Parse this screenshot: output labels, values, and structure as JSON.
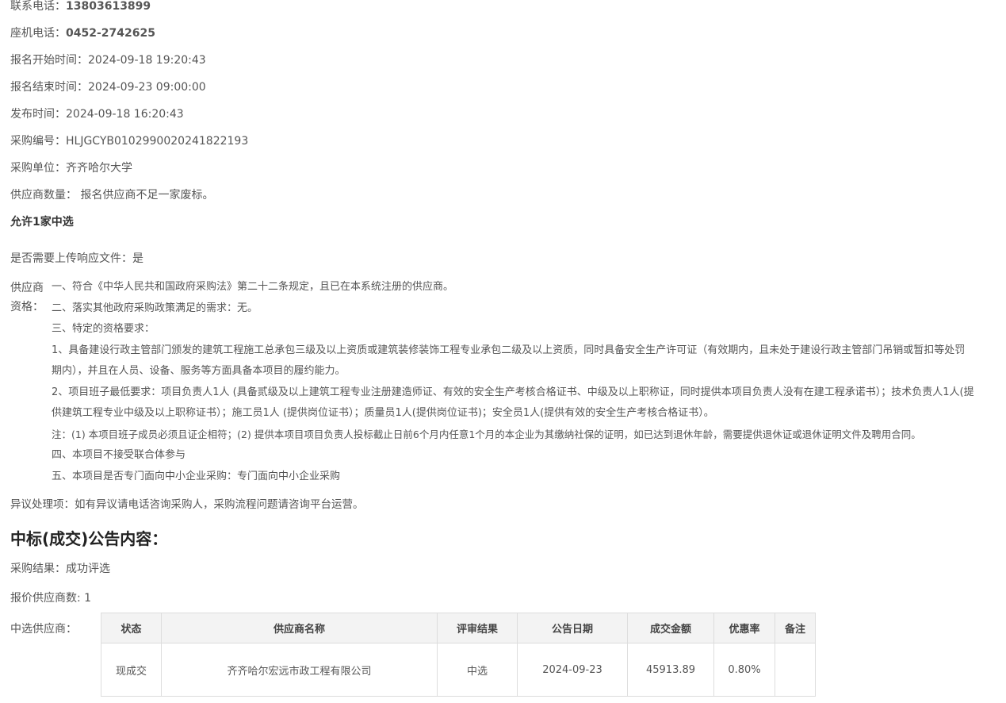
{
  "contact": {
    "phone_label": "联系电话：",
    "phone_value": "13803613899",
    "landline_label": "座机电话：",
    "landline_value": "0452-2742625"
  },
  "dates": {
    "signup_start_label": "报名开始时间：",
    "signup_start_value": "2024-09-18 19:20:43",
    "signup_end_label": "报名结束时间：",
    "signup_end_value": "2024-09-23 09:00:00",
    "publish_label": "发布时间：",
    "publish_value": "2024-09-18 16:20:43"
  },
  "procurement": {
    "code_label": "采购编号：",
    "code_value": "HLJGCYB0102990020241822193",
    "unit_label": "采购单位：",
    "unit_value": "齐齐哈尔大学",
    "supplier_count_label": "供应商数量：",
    "supplier_count_value": "报名供应商不足一家废标。",
    "allow_text": "允许1家中选",
    "upload_label": "是否需要上传响应文件：",
    "upload_value": "是"
  },
  "qualification": {
    "label": "供应商资格：",
    "lines": [
      "一、符合《中华人民共和国政府采购法》第二十二条规定，且已在本系统注册的供应商。",
      "二、落实其他政府采购政策满足的需求：无。",
      "三、特定的资格要求：",
      "1、具备建设行政主管部门颁发的建筑工程施工总承包三级及以上资质或建筑装修装饰工程专业承包二级及以上资质，同时具备安全生产许可证（有效期内，且未处于建设行政主管部门吊销或暂扣等处罚期内），并且在人员、设备、服务等方面具备本项目的履约能力。",
      "2、项目班子最低要求：项目负责人1人 (具备贰级及以上建筑工程专业注册建造师证、有效的安全生产考核合格证书、中级及以上职称证，同时提供本项目负责人没有在建工程承诺书）；技术负责人1人(提供建筑工程专业中级及以上职称证书）；施工员1人 (提供岗位证书）；质量员1人(提供岗位证书)；安全员1人(提供有效的安全生产考核合格证书）。",
      "注：(1) 本项目班子成员必须且证企相符；(2) 提供本项目项目负责人投标截止日前6个月内任意1个月的本企业为其缴纳社保的证明，如已达到退休年龄，需要提供退休证或退休证明文件及聘用合同。",
      "四、本项目不接受联合体参与",
      "五、本项目是否专门面向中小企业采购：专门面向中小企业采购"
    ]
  },
  "objection": {
    "label": "异议处理项：",
    "value": "如有异议请电话咨询采购人，采购流程问题请咨询平台运营。"
  },
  "result_section": {
    "title": "中标(成交)公告内容：",
    "result_label": "采购结果：",
    "result_value": "成功评选",
    "quote_count_text": "报价供应商数: 1",
    "winner_label": "中选供应商："
  },
  "table": {
    "headers": [
      "状态",
      "供应商名称",
      "评审结果",
      "公告日期",
      "成交金额",
      "优惠率",
      "备注"
    ],
    "rows": [
      [
        "现成交",
        "齐齐哈尔宏远市政工程有限公司",
        "中选",
        "2024-09-23",
        "45913.89",
        "0.80%",
        ""
      ]
    ]
  }
}
